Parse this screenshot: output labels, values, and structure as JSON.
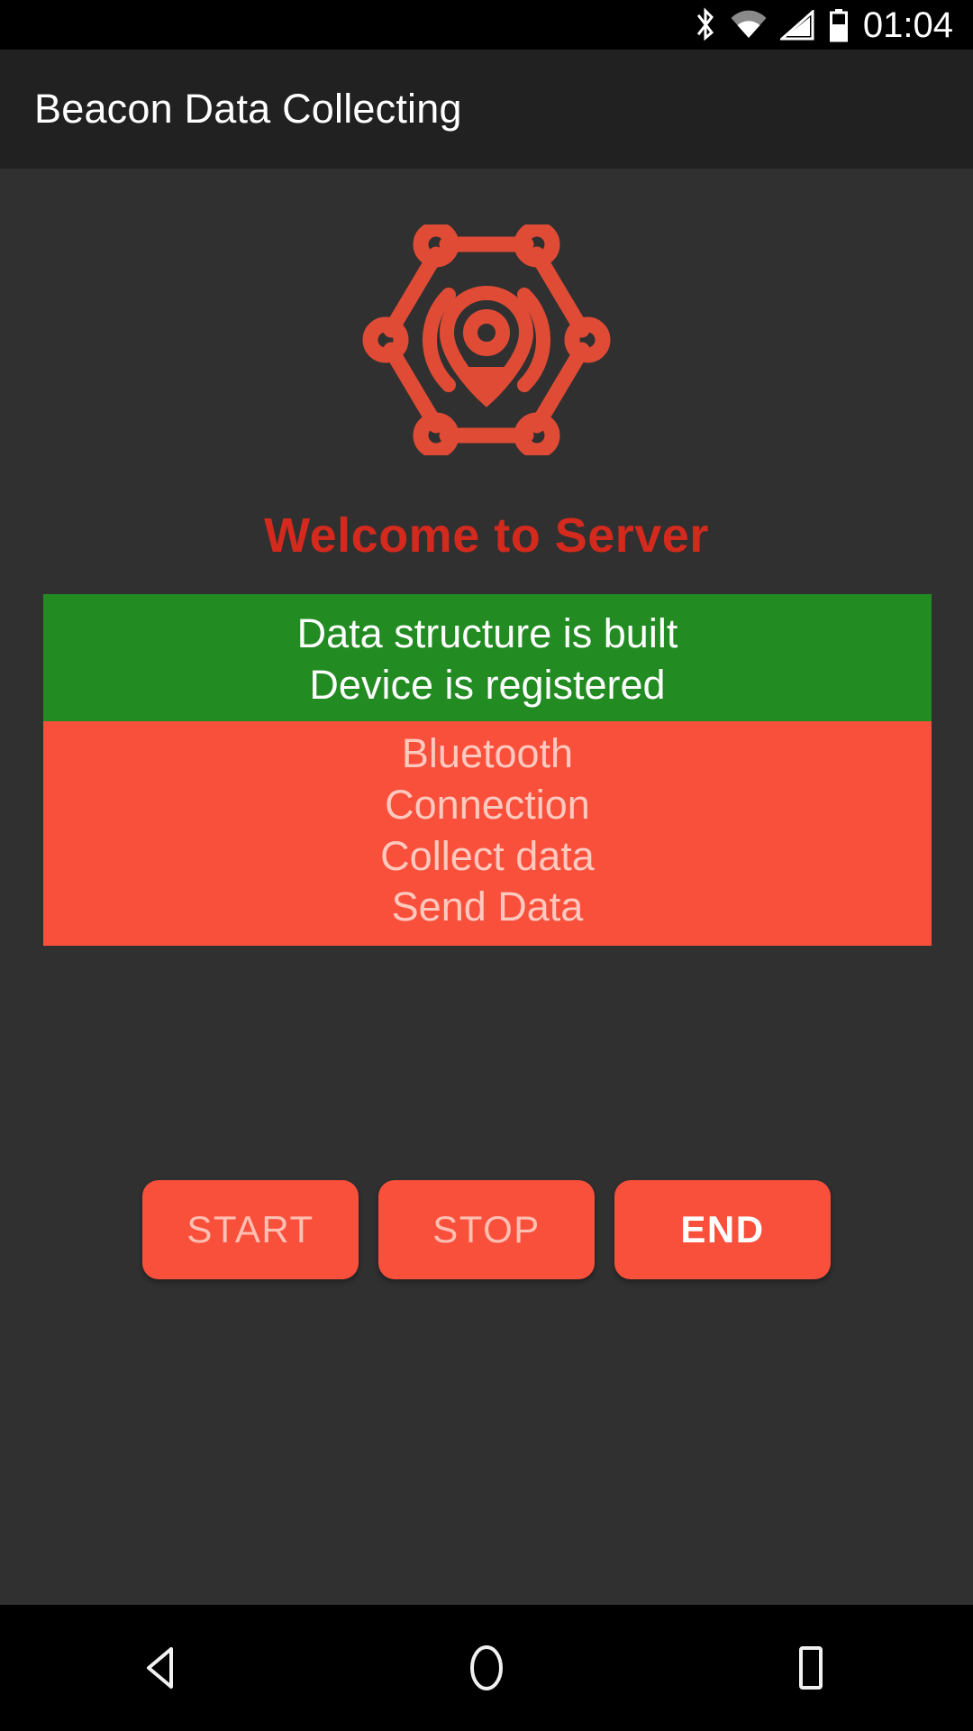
{
  "statusbar": {
    "time": "01:04",
    "icons": [
      "bluetooth-icon",
      "wifi-icon",
      "cellular-signal-icon",
      "battery-icon"
    ]
  },
  "toolbar": {
    "title": "Beacon Data Collecting"
  },
  "main": {
    "logo_name": "beacon-network-logo",
    "welcome_text": "Welcome to Server",
    "status_done": [
      "Data structure is built",
      "Device is registered"
    ],
    "status_pending": [
      "Bluetooth",
      "Connection",
      "Collect data",
      "Send Data"
    ]
  },
  "buttons": [
    {
      "label": "START",
      "enabled": false
    },
    {
      "label": "STOP",
      "enabled": false
    },
    {
      "label": "END",
      "enabled": true
    }
  ],
  "navbar": {
    "back": "back-triangle-icon",
    "home": "home-circle-icon",
    "recents": "recents-square-icon"
  },
  "colors": {
    "statusbar_bg": "#000000",
    "toolbar_bg": "#212121",
    "page_bg": "#303030",
    "accent_red": "#F9503C",
    "welcome_red": "#D4291D",
    "success_green": "#228B22",
    "pending_text": "#FFC9BF",
    "text_white": "#FFFFFF"
  }
}
